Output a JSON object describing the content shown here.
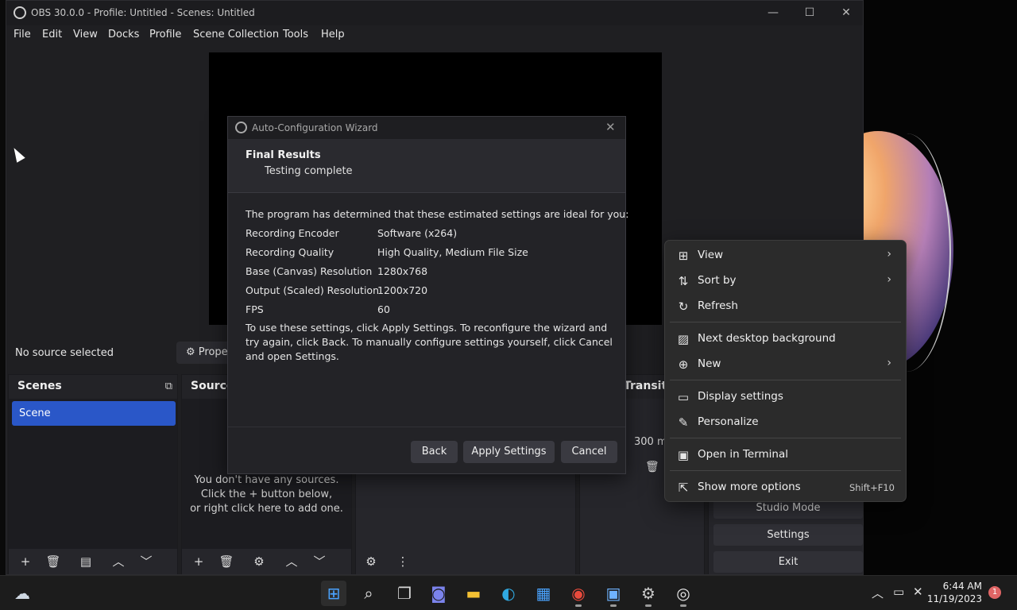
{
  "window": {
    "title": "OBS 30.0.0 - Profile: Untitled - Scenes: Untitled",
    "minimize": "—",
    "maximize": "☐",
    "close": "✕"
  },
  "menubar": [
    "File",
    "Edit",
    "View",
    "Docks",
    "Profile",
    "Scene Collection",
    "Tools",
    "Help"
  ],
  "context_bar": {
    "no_source": "No source selected",
    "properties": "⚙ Prope"
  },
  "docks": {
    "scenes": {
      "title": "Scenes",
      "item": "Scene"
    },
    "sources": {
      "title": "Sources",
      "empty": "You don't have any sources.\nClick the + button below,\nor right click here to add one."
    },
    "transitions": {
      "title": "Transiti",
      "duration": "300 m"
    },
    "controls": {
      "studio_mode": "Studio Mode",
      "settings": "Settings",
      "exit": "Exit"
    }
  },
  "dialog": {
    "title": "Auto-Configuration Wizard",
    "heading": "Final Results",
    "subheading": "Testing complete",
    "intro": "The program has determined that these estimated settings are ideal for you:",
    "results": [
      {
        "label": "Recording Encoder",
        "value": "Software (x264)"
      },
      {
        "label": "Recording Quality",
        "value": "High Quality, Medium File Size"
      },
      {
        "label": "Base (Canvas) Resolution",
        "value": "1280x768"
      },
      {
        "label": "Output (Scaled) Resolution",
        "value": "1200x720"
      },
      {
        "label": "FPS",
        "value": "60"
      }
    ],
    "outro": "To use these settings, click Apply Settings. To reconfigure the wizard and try again, click Back. To manually configure settings yourself, click Cancel and open Settings.",
    "buttons": {
      "back": "Back",
      "apply": "Apply Settings",
      "cancel": "Cancel"
    }
  },
  "desktop_menu": [
    {
      "label": "View",
      "icon": "grid-icon",
      "submenu": true
    },
    {
      "label": "Sort by",
      "icon": "sort-icon",
      "submenu": true
    },
    {
      "label": "Refresh",
      "icon": "refresh-icon",
      "submenu": false
    },
    {
      "label": "Next desktop background",
      "icon": "image-icon",
      "submenu": false
    },
    {
      "label": "New",
      "icon": "plus-circle-icon",
      "submenu": true
    },
    {
      "label": "Display settings",
      "icon": "display-icon",
      "submenu": false
    },
    {
      "label": "Personalize",
      "icon": "pen-icon",
      "submenu": false
    },
    {
      "label": "Open in Terminal",
      "icon": "terminal-icon",
      "submenu": false
    },
    {
      "label": "Show more options",
      "icon": "share-icon",
      "submenu": false,
      "shortcut": "Shift+F10"
    }
  ],
  "taskbar": {
    "clock_time": "6:44 AM",
    "clock_date": "11/19/2023",
    "notifications": "1"
  },
  "colors": {
    "accent": "#2a57c8",
    "window_bg": "#1f1f22",
    "menu_bg": "#2b2b2b"
  }
}
